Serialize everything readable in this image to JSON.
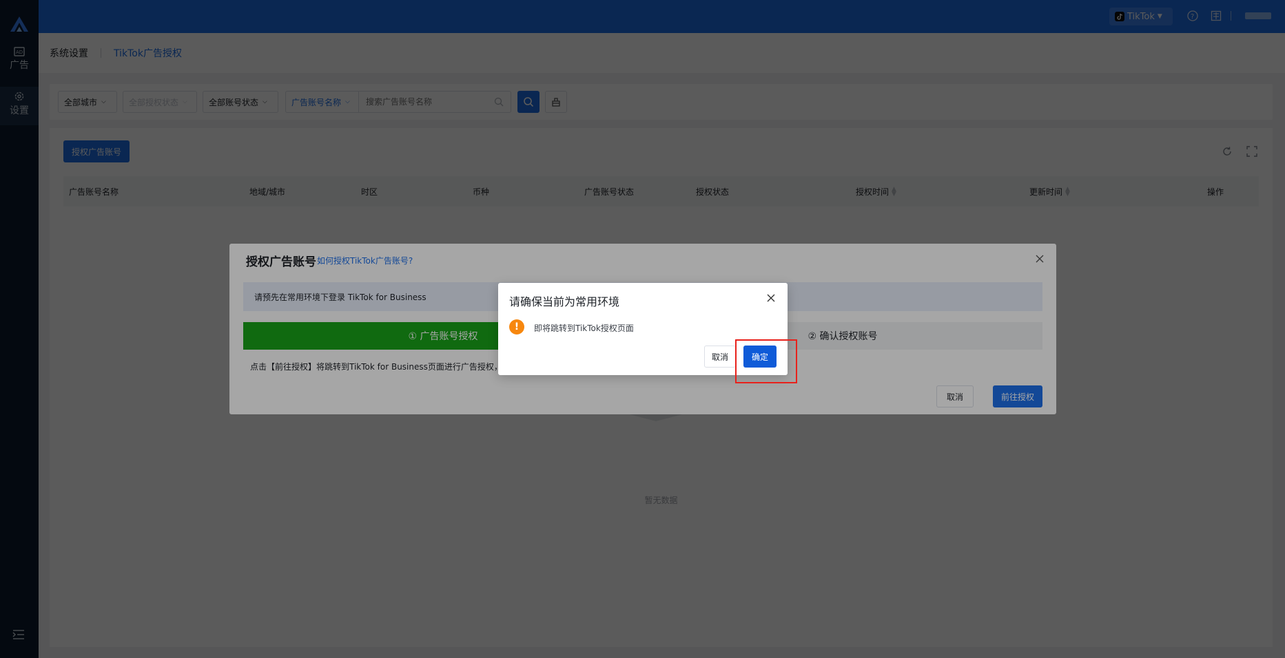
{
  "sidebar": {
    "items": [
      {
        "label": "广告",
        "icon": "ad-icon"
      },
      {
        "label": "设置",
        "icon": "gear-icon"
      }
    ]
  },
  "topbar": {
    "platform_label": "TikTok"
  },
  "breadcrumb": {
    "parent": "系统设置",
    "current": "TikTok广告授权"
  },
  "filters": {
    "city": "全部城市",
    "auth_status": "全部授权状态",
    "account_status": "全部账号状态",
    "search_kind": "广告账号名称",
    "search_placeholder": "搜索广告账号名称"
  },
  "toolbar": {
    "authorize_button": "授权广告账号"
  },
  "table": {
    "columns": [
      "广告账号名称",
      "地域/城市",
      "时区",
      "币种",
      "广告账号状态",
      "授权状态",
      "授权时间",
      "更新时间",
      "操作"
    ],
    "empty_text": "暂无数据"
  },
  "auth_modal": {
    "title": "授权广告账号",
    "help_link": "如何授权TikTok广告账号?",
    "notice": "请预先在常用环境下登录 TikTok for Business",
    "steps": [
      "① 广告账号授权",
      "② 确认授权账号"
    ],
    "description": "点击【前往授权】将跳转到TikTok for Business页面进行广告授权，",
    "cancel_label": "取消",
    "go_label": "前往授权"
  },
  "confirm_dialog": {
    "title": "请确保当前为常用环境",
    "message": "即将跳转到TikTok授权页面",
    "cancel_label": "取消",
    "ok_label": "确定",
    "warning_color": "#f7870e"
  },
  "colors": {
    "primary": "#1e6fe8",
    "sidebar": "#0d1b2e",
    "step_active": "#1aa31a",
    "highlight": "#e8211b"
  }
}
